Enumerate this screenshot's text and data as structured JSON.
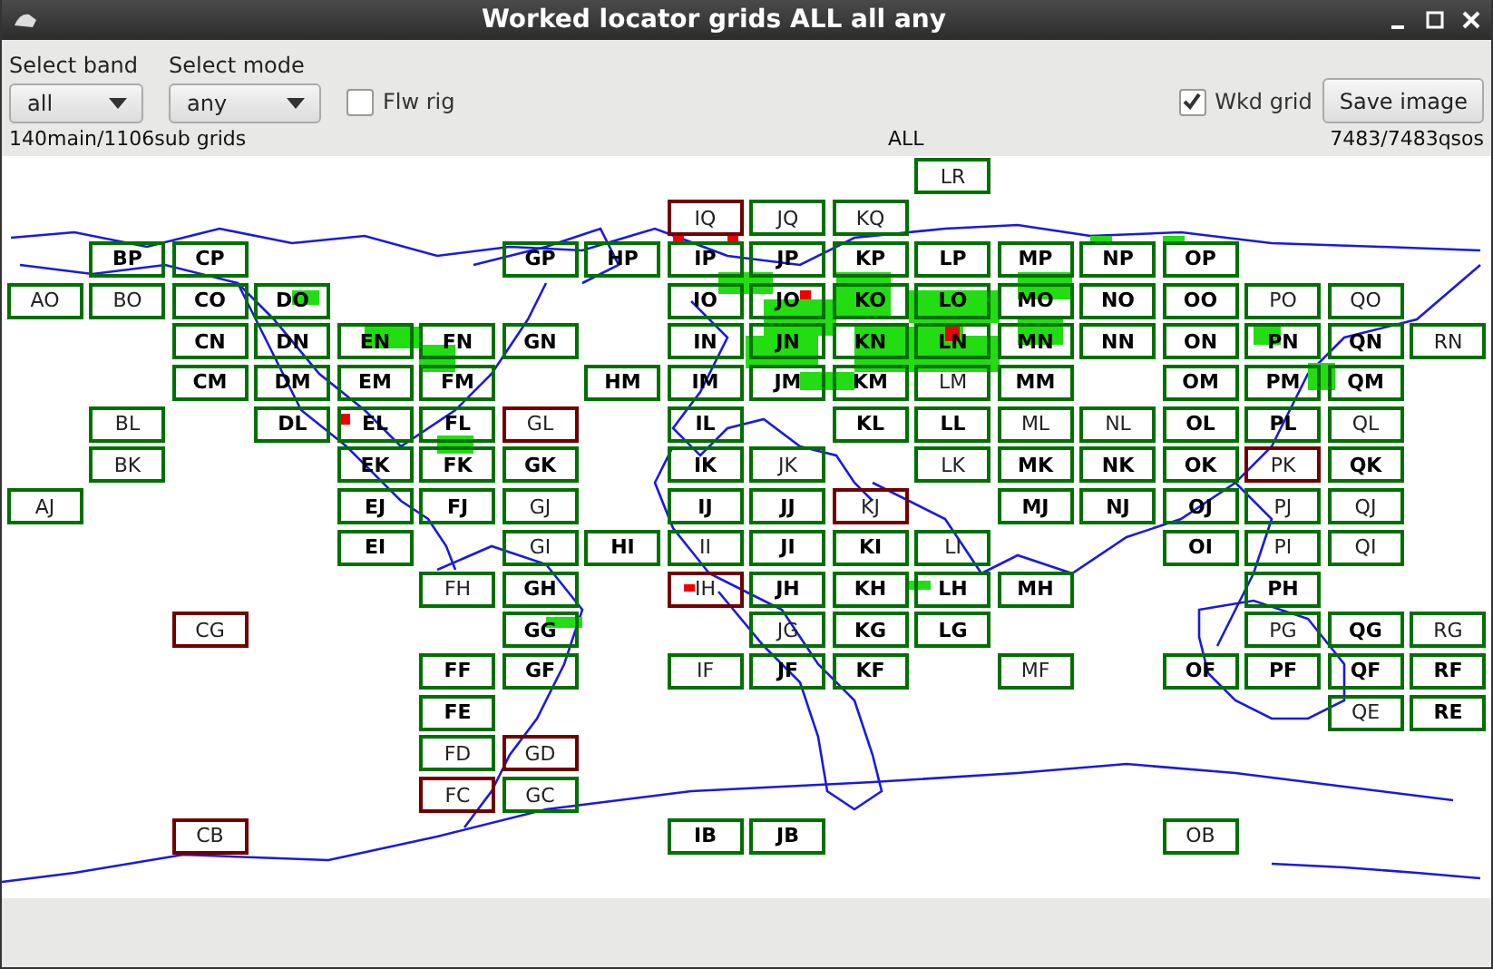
{
  "window": {
    "title": "Worked locator grids ALL all any"
  },
  "band": {
    "label": "Select band",
    "value": "all"
  },
  "mode": {
    "label": "Select mode",
    "value": "any"
  },
  "follow_rig": {
    "label": "Flw rig",
    "checked": false
  },
  "worked_grid": {
    "label": "Wkd grid",
    "checked": true
  },
  "save_button": "Save image",
  "status": {
    "grids": "140main/1106sub grids",
    "band": "ALL",
    "qsos": "7483/7483qsos"
  },
  "grids": [
    {
      "label": "LR",
      "worked": true,
      "bold": false
    },
    {
      "label": "IQ",
      "worked": false,
      "bold": false
    },
    {
      "label": "JQ",
      "worked": true,
      "bold": false
    },
    {
      "label": "KQ",
      "worked": true,
      "bold": false
    },
    {
      "label": "BP",
      "worked": true,
      "bold": true
    },
    {
      "label": "CP",
      "worked": true,
      "bold": true
    },
    {
      "label": "GP",
      "worked": true,
      "bold": true
    },
    {
      "label": "HP",
      "worked": true,
      "bold": true
    },
    {
      "label": "IP",
      "worked": true,
      "bold": true
    },
    {
      "label": "JP",
      "worked": true,
      "bold": true
    },
    {
      "label": "KP",
      "worked": true,
      "bold": true
    },
    {
      "label": "LP",
      "worked": true,
      "bold": true
    },
    {
      "label": "MP",
      "worked": true,
      "bold": true
    },
    {
      "label": "NP",
      "worked": true,
      "bold": true
    },
    {
      "label": "OP",
      "worked": true,
      "bold": true
    },
    {
      "label": "AO",
      "worked": true,
      "bold": false
    },
    {
      "label": "BO",
      "worked": true,
      "bold": false
    },
    {
      "label": "CO",
      "worked": true,
      "bold": true
    },
    {
      "label": "DO",
      "worked": true,
      "bold": true
    },
    {
      "label": "IO",
      "worked": true,
      "bold": true
    },
    {
      "label": "JO",
      "worked": true,
      "bold": true
    },
    {
      "label": "KO",
      "worked": true,
      "bold": true
    },
    {
      "label": "LO",
      "worked": true,
      "bold": true
    },
    {
      "label": "MO",
      "worked": true,
      "bold": true
    },
    {
      "label": "NO",
      "worked": true,
      "bold": true
    },
    {
      "label": "OO",
      "worked": true,
      "bold": true
    },
    {
      "label": "PO",
      "worked": true,
      "bold": false
    },
    {
      "label": "QO",
      "worked": true,
      "bold": false
    },
    {
      "label": "CN",
      "worked": true,
      "bold": true
    },
    {
      "label": "DN",
      "worked": true,
      "bold": true
    },
    {
      "label": "EN",
      "worked": true,
      "bold": true
    },
    {
      "label": "FN",
      "worked": true,
      "bold": true
    },
    {
      "label": "GN",
      "worked": true,
      "bold": true
    },
    {
      "label": "IN",
      "worked": true,
      "bold": true
    },
    {
      "label": "JN",
      "worked": true,
      "bold": true
    },
    {
      "label": "KN",
      "worked": true,
      "bold": true
    },
    {
      "label": "LN",
      "worked": true,
      "bold": true
    },
    {
      "label": "MN",
      "worked": true,
      "bold": true
    },
    {
      "label": "NN",
      "worked": true,
      "bold": true
    },
    {
      "label": "ON",
      "worked": true,
      "bold": true
    },
    {
      "label": "PN",
      "worked": true,
      "bold": true
    },
    {
      "label": "QN",
      "worked": true,
      "bold": true
    },
    {
      "label": "RN",
      "worked": true,
      "bold": false
    },
    {
      "label": "CM",
      "worked": true,
      "bold": true
    },
    {
      "label": "DM",
      "worked": true,
      "bold": true
    },
    {
      "label": "EM",
      "worked": true,
      "bold": true
    },
    {
      "label": "FM",
      "worked": true,
      "bold": true
    },
    {
      "label": "HM",
      "worked": true,
      "bold": true
    },
    {
      "label": "IM",
      "worked": true,
      "bold": true
    },
    {
      "label": "JM",
      "worked": true,
      "bold": true
    },
    {
      "label": "KM",
      "worked": true,
      "bold": true
    },
    {
      "label": "LM",
      "worked": true,
      "bold": false
    },
    {
      "label": "MM",
      "worked": true,
      "bold": true
    },
    {
      "label": "OM",
      "worked": true,
      "bold": true
    },
    {
      "label": "PM",
      "worked": true,
      "bold": true
    },
    {
      "label": "QM",
      "worked": true,
      "bold": true
    },
    {
      "label": "BL",
      "worked": true,
      "bold": false
    },
    {
      "label": "DL",
      "worked": true,
      "bold": true
    },
    {
      "label": "EL",
      "worked": true,
      "bold": true
    },
    {
      "label": "FL",
      "worked": true,
      "bold": true
    },
    {
      "label": "GL",
      "worked": false,
      "bold": false
    },
    {
      "label": "IL",
      "worked": true,
      "bold": true
    },
    {
      "label": "KL",
      "worked": true,
      "bold": true
    },
    {
      "label": "LL",
      "worked": true,
      "bold": true
    },
    {
      "label": "ML",
      "worked": true,
      "bold": false
    },
    {
      "label": "NL",
      "worked": true,
      "bold": false
    },
    {
      "label": "OL",
      "worked": true,
      "bold": true
    },
    {
      "label": "PL",
      "worked": true,
      "bold": true
    },
    {
      "label": "QL",
      "worked": true,
      "bold": false
    },
    {
      "label": "BK",
      "worked": true,
      "bold": false
    },
    {
      "label": "EK",
      "worked": true,
      "bold": true
    },
    {
      "label": "FK",
      "worked": true,
      "bold": true
    },
    {
      "label": "GK",
      "worked": true,
      "bold": true
    },
    {
      "label": "IK",
      "worked": true,
      "bold": true
    },
    {
      "label": "JK",
      "worked": true,
      "bold": false
    },
    {
      "label": "LK",
      "worked": true,
      "bold": false
    },
    {
      "label": "MK",
      "worked": true,
      "bold": true
    },
    {
      "label": "NK",
      "worked": true,
      "bold": true
    },
    {
      "label": "OK",
      "worked": true,
      "bold": true
    },
    {
      "label": "PK",
      "worked": false,
      "bold": false
    },
    {
      "label": "QK",
      "worked": true,
      "bold": true
    },
    {
      "label": "AJ",
      "worked": true,
      "bold": false
    },
    {
      "label": "EJ",
      "worked": true,
      "bold": true
    },
    {
      "label": "FJ",
      "worked": true,
      "bold": true
    },
    {
      "label": "GJ",
      "worked": true,
      "bold": false
    },
    {
      "label": "IJ",
      "worked": true,
      "bold": true
    },
    {
      "label": "JJ",
      "worked": true,
      "bold": true
    },
    {
      "label": "KJ",
      "worked": false,
      "bold": false
    },
    {
      "label": "MJ",
      "worked": true,
      "bold": true
    },
    {
      "label": "NJ",
      "worked": true,
      "bold": true
    },
    {
      "label": "OJ",
      "worked": true,
      "bold": true
    },
    {
      "label": "PJ",
      "worked": true,
      "bold": false
    },
    {
      "label": "QJ",
      "worked": true,
      "bold": false
    },
    {
      "label": "EI",
      "worked": true,
      "bold": true
    },
    {
      "label": "GI",
      "worked": true,
      "bold": false
    },
    {
      "label": "HI",
      "worked": true,
      "bold": true
    },
    {
      "label": "II",
      "worked": true,
      "bold": false
    },
    {
      "label": "JI",
      "worked": true,
      "bold": true
    },
    {
      "label": "KI",
      "worked": true,
      "bold": true
    },
    {
      "label": "LI",
      "worked": true,
      "bold": false
    },
    {
      "label": "OI",
      "worked": true,
      "bold": true
    },
    {
      "label": "PI",
      "worked": true,
      "bold": false
    },
    {
      "label": "QI",
      "worked": true,
      "bold": false
    },
    {
      "label": "FH",
      "worked": true,
      "bold": false
    },
    {
      "label": "GH",
      "worked": true,
      "bold": true
    },
    {
      "label": "IH",
      "worked": false,
      "bold": false
    },
    {
      "label": "JH",
      "worked": true,
      "bold": true
    },
    {
      "label": "KH",
      "worked": true,
      "bold": true
    },
    {
      "label": "LH",
      "worked": true,
      "bold": true
    },
    {
      "label": "MH",
      "worked": true,
      "bold": true
    },
    {
      "label": "PH",
      "worked": true,
      "bold": true
    },
    {
      "label": "CG",
      "worked": false,
      "bold": false
    },
    {
      "label": "GG",
      "worked": true,
      "bold": true
    },
    {
      "label": "JG",
      "worked": true,
      "bold": false
    },
    {
      "label": "KG",
      "worked": true,
      "bold": true
    },
    {
      "label": "LG",
      "worked": true,
      "bold": true
    },
    {
      "label": "PG",
      "worked": true,
      "bold": false
    },
    {
      "label": "QG",
      "worked": true,
      "bold": true
    },
    {
      "label": "RG",
      "worked": true,
      "bold": false
    },
    {
      "label": "FF",
      "worked": true,
      "bold": true
    },
    {
      "label": "GF",
      "worked": true,
      "bold": true
    },
    {
      "label": "IF",
      "worked": true,
      "bold": false
    },
    {
      "label": "JF",
      "worked": true,
      "bold": true
    },
    {
      "label": "KF",
      "worked": true,
      "bold": true
    },
    {
      "label": "MF",
      "worked": true,
      "bold": false
    },
    {
      "label": "OF",
      "worked": true,
      "bold": true
    },
    {
      "label": "PF",
      "worked": true,
      "bold": true
    },
    {
      "label": "QF",
      "worked": true,
      "bold": true
    },
    {
      "label": "RF",
      "worked": true,
      "bold": true
    },
    {
      "label": "FE",
      "worked": true,
      "bold": true
    },
    {
      "label": "QE",
      "worked": true,
      "bold": false
    },
    {
      "label": "RE",
      "worked": true,
      "bold": true
    },
    {
      "label": "FD",
      "worked": true,
      "bold": false
    },
    {
      "label": "GD",
      "worked": false,
      "bold": false
    },
    {
      "label": "FC",
      "worked": false,
      "bold": false
    },
    {
      "label": "GC",
      "worked": true,
      "bold": false
    },
    {
      "label": "CB",
      "worked": false,
      "bold": false
    },
    {
      "label": "IB",
      "worked": true,
      "bold": true
    },
    {
      "label": "JB",
      "worked": true,
      "bold": true
    },
    {
      "label": "OB",
      "worked": true,
      "bold": false
    }
  ]
}
